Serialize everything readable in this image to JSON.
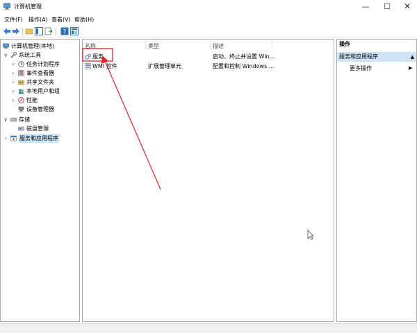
{
  "window": {
    "title": "计算机管理",
    "min_glyph": "—",
    "max_glyph": "☐",
    "close_glyph": "✕"
  },
  "menubar": [
    "文件(F)",
    "操作(A)",
    "查看(V)",
    "帮助(H)"
  ],
  "tree": {
    "root": "计算机管理(本地)",
    "system_tools": "系统工具",
    "task_scheduler": "任务计划程序",
    "event_viewer": "事件查看器",
    "shared_folders": "共享文件夹",
    "local_users": "本地用户和组",
    "performance": "性能",
    "device_manager": "设备管理器",
    "storage": "存储",
    "disk_management": "磁盘管理",
    "services_apps": "服务和应用程序",
    "expanded_glyph": "∨",
    "collapsed_glyph": "›"
  },
  "list": {
    "columns": [
      "名称",
      "类型",
      "描述"
    ],
    "rows": [
      {
        "name": "服务",
        "type": "",
        "desc": "启动、终止并设置 Win..."
      },
      {
        "name": "WMI 控件",
        "type": "扩展管理单元",
        "desc": "配置和控制 Windows ..."
      }
    ]
  },
  "actions": {
    "header": "操作",
    "section": "服务和应用程序",
    "section_arrow": "▲",
    "item": "更多操作",
    "item_arrow": "▶"
  },
  "colors": {
    "selection": "#cce8ff",
    "action_section_bg": "#cfe3f7",
    "annotation_red": "#e8202a"
  }
}
